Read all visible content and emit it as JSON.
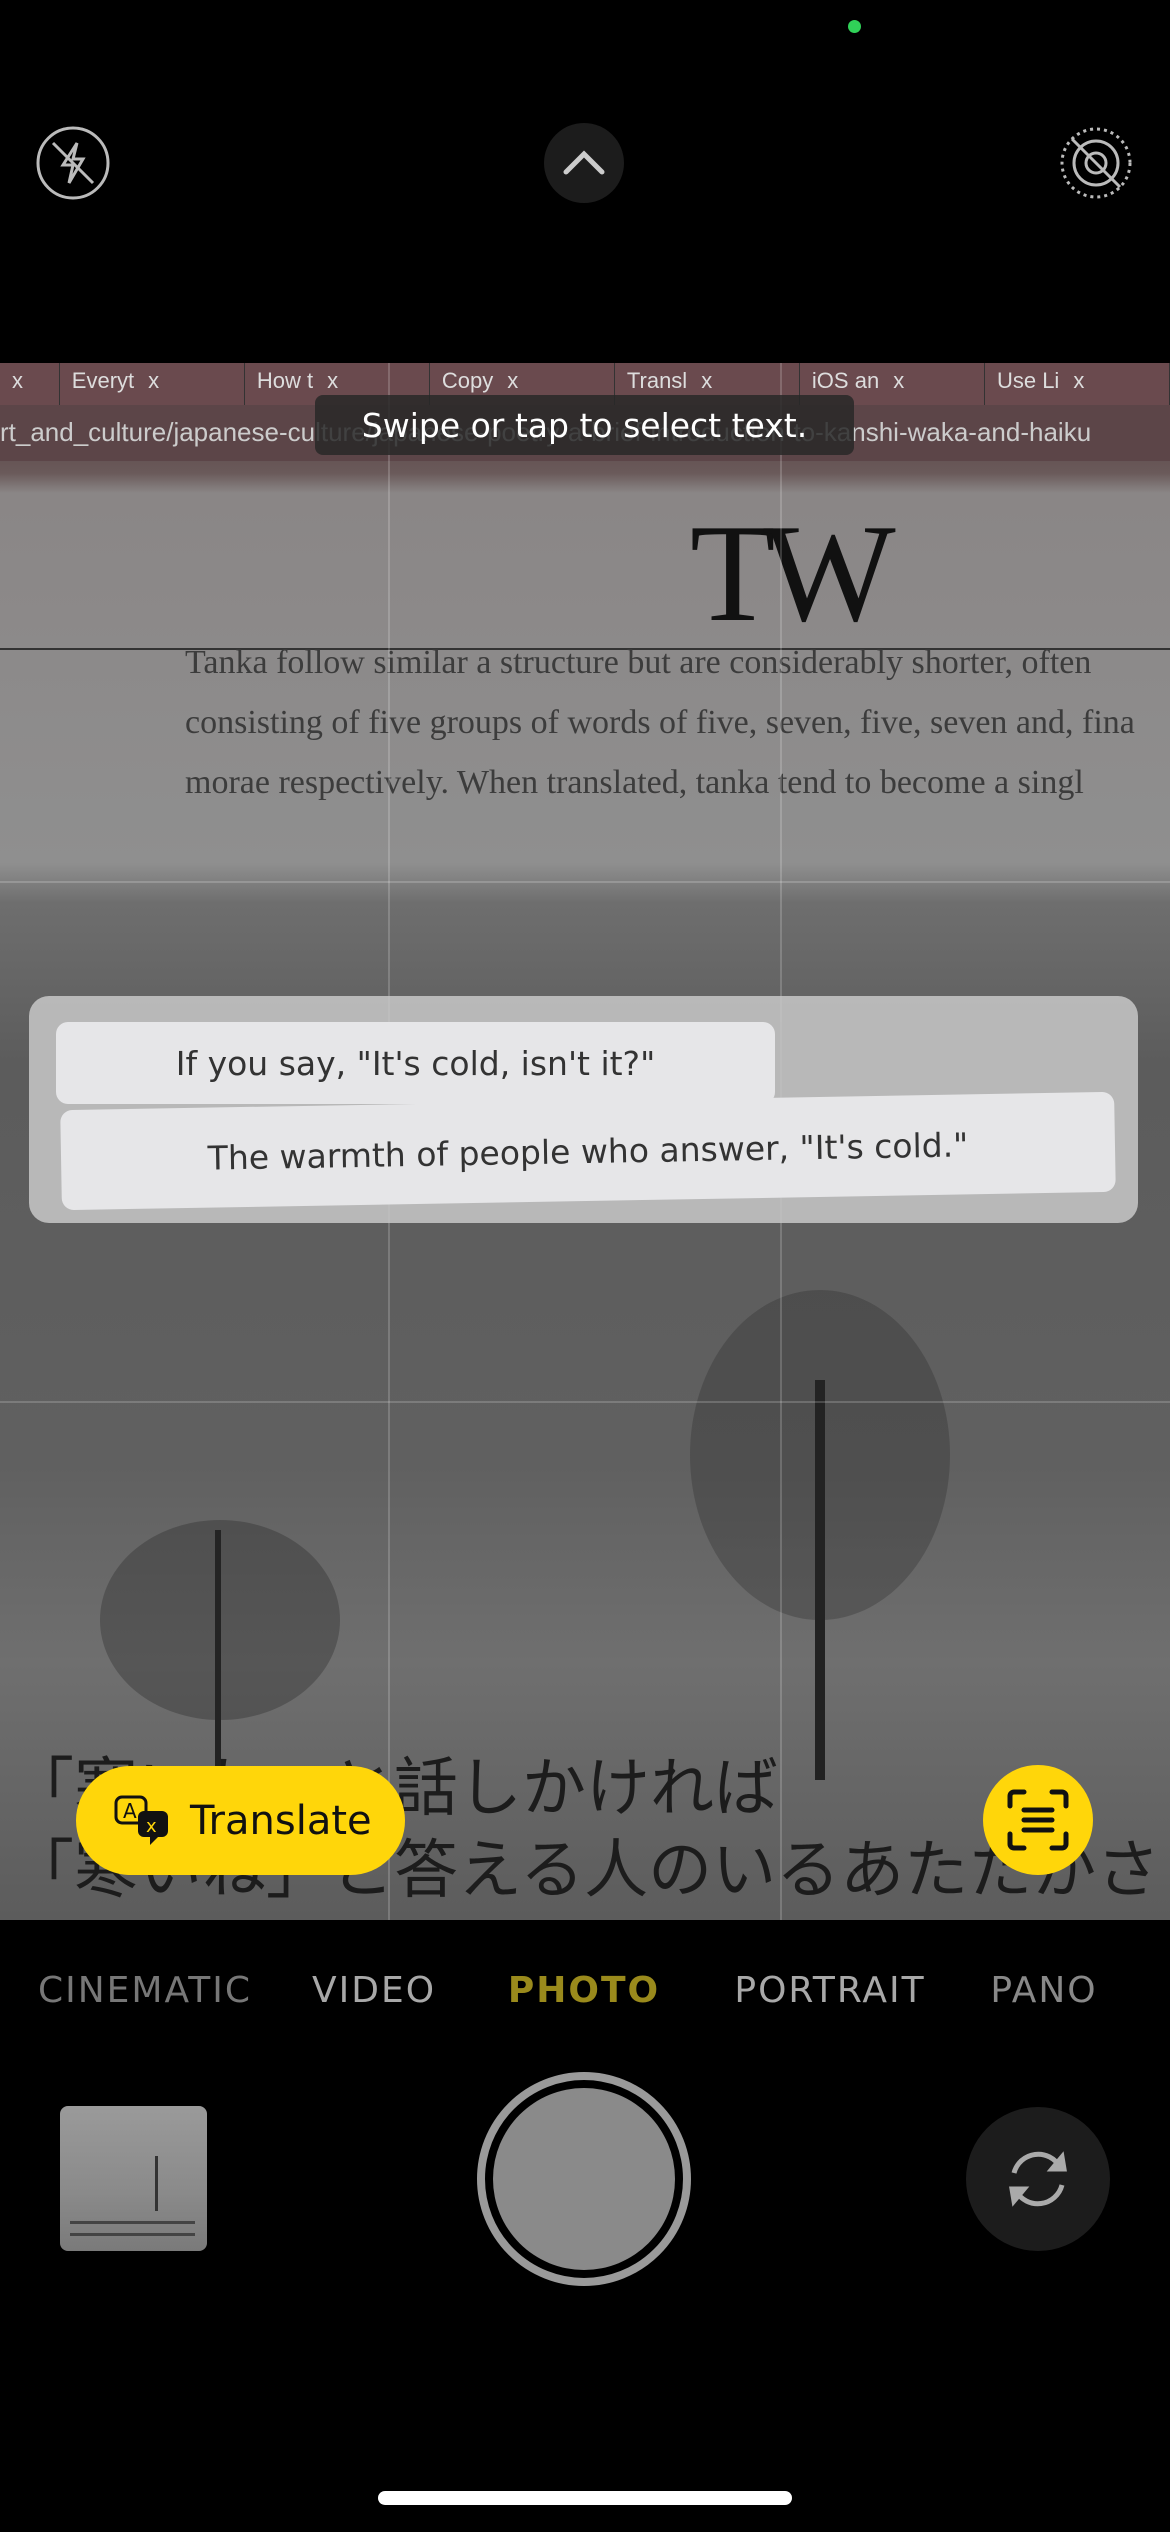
{
  "status": {
    "privacy_indicator_color": "#30d158"
  },
  "top_controls": {
    "flash": {
      "icon": "flash-off-icon"
    },
    "expand": {
      "icon": "chevron-up-icon"
    },
    "live": {
      "icon": "live-photo-off-icon"
    }
  },
  "viewfinder": {
    "browser_tabs": [
      "Everyt",
      "How t",
      "Copy",
      "Transl",
      "iOS an",
      "Use Li"
    ],
    "url_text": "rt_and_culture/japanese-culture/japanese-poetry-a-brief-introduction-to-kanshi-waka-and-haiku",
    "logo": "TW",
    "article_lines": [
      "Tanka follow similar a structure but are considerably shorter, often",
      "consisting of five groups of words of five, seven, five, seven and, fina",
      "morae respectively. When translated, tanka tend to become a singl"
    ],
    "japanese_lines": [
      "「寒いね」と話しかければ",
      "「寒いね」と答える人のいるあたたかさ"
    ],
    "hint": "Swipe or tap to select text.",
    "translation": {
      "lines": [
        "If you say, \"It's cold, isn't it?\"",
        "The warmth of people who answer, \"It's cold.\""
      ]
    },
    "translate_button": {
      "label": "Translate",
      "icon": "translate-icon",
      "color": "#ffd60a"
    },
    "scan_button": {
      "icon": "text-scan-icon"
    }
  },
  "modes": {
    "items": [
      "CINEMATIC",
      "VIDEO",
      "PHOTO",
      "PORTRAIT",
      "PANO"
    ],
    "selected": "PHOTO",
    "accent": "#ffd60a"
  },
  "bottom": {
    "thumbnail": "last-photo",
    "shutter": "shutter-button",
    "flip": {
      "icon": "camera-flip-icon"
    }
  }
}
